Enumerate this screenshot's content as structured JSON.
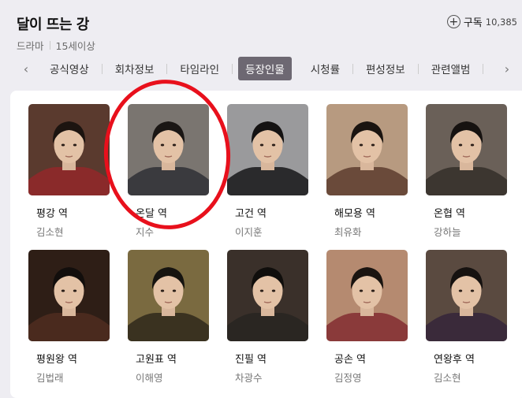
{
  "header": {
    "title": "달이 뜨는 강",
    "genre": "드라마",
    "rating": "15세이상",
    "subscribe_label": "구독",
    "subscribe_count": "10,385"
  },
  "tabs": [
    {
      "label": "공식영상",
      "active": false
    },
    {
      "label": "회차정보",
      "active": false
    },
    {
      "label": "타임라인",
      "active": false
    },
    {
      "label": "등장인물",
      "active": true
    },
    {
      "label": "시청률",
      "active": false
    },
    {
      "label": "편성정보",
      "active": false
    },
    {
      "label": "관련앨범",
      "active": false
    }
  ],
  "cast": [
    {
      "role": "평강 역",
      "actor": "김소현",
      "costume": "#8a2a2a",
      "bg": "#5a3a2e",
      "hair": "#1c1410"
    },
    {
      "role": "온달 역",
      "actor": "지수",
      "costume": "#3a3a3e",
      "bg": "#7a7570",
      "hair": "#1a1614"
    },
    {
      "role": "고건 역",
      "actor": "이지훈",
      "costume": "#2a2a2c",
      "bg": "#9a9a9c",
      "hair": "#141212"
    },
    {
      "role": "해모용 역",
      "actor": "최유화",
      "costume": "#6a4a3a",
      "bg": "#b79a80",
      "hair": "#1a1410"
    },
    {
      "role": "온협 역",
      "actor": "강하늘",
      "costume": "#3c3630",
      "bg": "#6a6058",
      "hair": "#161210"
    },
    {
      "role": "평원왕 역",
      "actor": "김법래",
      "costume": "#4a2a1e",
      "bg": "#2e1e16",
      "hair": "#120e0c"
    },
    {
      "role": "고원표 역",
      "actor": "이해영",
      "costume": "#3a3220",
      "bg": "#7a6a40",
      "hair": "#161410"
    },
    {
      "role": "진필 역",
      "actor": "차광수",
      "costume": "#2a2622",
      "bg": "#3a302a",
      "hair": "#100e0c"
    },
    {
      "role": "공손 역",
      "actor": "김정영",
      "costume": "#8a3a3a",
      "bg": "#b58a70",
      "hair": "#1a1410"
    },
    {
      "role": "연왕후 역",
      "actor": "김소현",
      "costume": "#3a2a3a",
      "bg": "#5a4a40",
      "hair": "#161210"
    }
  ],
  "colors": {
    "active_tab": "#6d6872",
    "highlight_ring": "#e8101c"
  }
}
